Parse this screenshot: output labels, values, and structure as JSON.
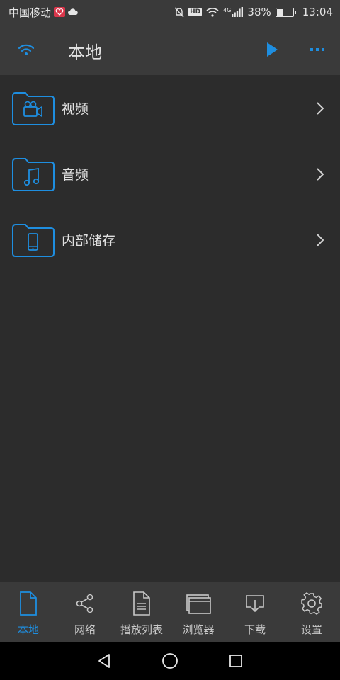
{
  "status_bar": {
    "carrier": "中国移动",
    "network": "4G",
    "battery_percent": "38%",
    "battery_level": 0.38,
    "time": "13:04",
    "hd_badge": "HD"
  },
  "app_bar": {
    "title": "本地",
    "icons": [
      "wifi-icon",
      "play-icon",
      "more-icon"
    ]
  },
  "colors": {
    "accent": "#1e8ee0",
    "background": "#2c2c2c",
    "bar": "#3a3a3a"
  },
  "list": {
    "items": [
      {
        "label": "视频",
        "icon": "video-folder-icon"
      },
      {
        "label": "音频",
        "icon": "music-folder-icon"
      },
      {
        "label": "内部储存",
        "icon": "phone-folder-icon"
      }
    ]
  },
  "bottom_nav": {
    "items": [
      {
        "label": "本地",
        "icon": "file-icon",
        "active": true
      },
      {
        "label": "网络",
        "icon": "share-icon",
        "active": false
      },
      {
        "label": "播放列表",
        "icon": "playlist-icon",
        "active": false
      },
      {
        "label": "浏览器",
        "icon": "browser-icon",
        "active": false
      },
      {
        "label": "下载",
        "icon": "download-icon",
        "active": false
      },
      {
        "label": "设置",
        "icon": "gear-icon",
        "active": false
      }
    ]
  }
}
